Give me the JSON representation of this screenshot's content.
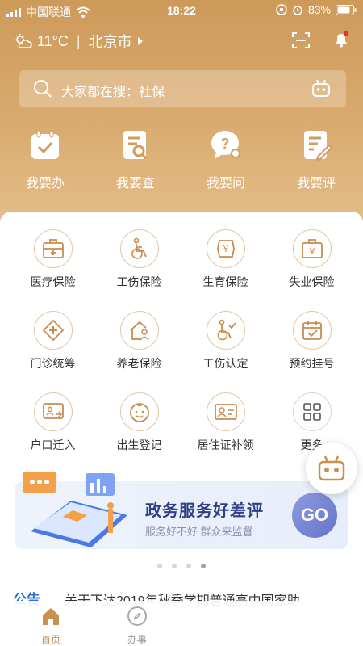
{
  "status": {
    "carrier": "中国联通",
    "time": "18:22",
    "battery": "83%"
  },
  "header": {
    "temperature": "11°C",
    "city": "北京市"
  },
  "search": {
    "placeholder": "大家都在搜：社保"
  },
  "quick_actions": [
    {
      "label": "我要办",
      "icon": "calendar-check-icon"
    },
    {
      "label": "我要查",
      "icon": "document-search-icon"
    },
    {
      "label": "我要问",
      "icon": "question-bubble-icon"
    },
    {
      "label": "我要评",
      "icon": "document-edit-icon"
    }
  ],
  "services": [
    {
      "label": "医疗保险",
      "icon": "medical-kit-icon"
    },
    {
      "label": "工伤保险",
      "icon": "wheelchair-icon"
    },
    {
      "label": "生育保险",
      "icon": "yen-shield-icon"
    },
    {
      "label": "失业保险",
      "icon": "yen-briefcase-icon"
    },
    {
      "label": "门诊统筹",
      "icon": "clinic-cross-icon"
    },
    {
      "label": "养老保险",
      "icon": "house-person-icon"
    },
    {
      "label": "工伤认定",
      "icon": "wheelchair-check-icon"
    },
    {
      "label": "预约挂号",
      "icon": "calendar-check-icon"
    },
    {
      "label": "户口迁入",
      "icon": "id-transfer-icon"
    },
    {
      "label": "出生登记",
      "icon": "baby-face-icon"
    },
    {
      "label": "居住证补领",
      "icon": "id-card-icon"
    },
    {
      "label": "更多",
      "icon": "grid-more-icon"
    }
  ],
  "banner": {
    "title": "政务服务好差评",
    "subtitle": "服务好不好  群众来监督",
    "button": "GO"
  },
  "notice": {
    "tag": "公告",
    "text": "关于下达2019年秋季学期普通高中国家助"
  },
  "tabs": [
    {
      "label": "首页",
      "active": true
    },
    {
      "label": "办事",
      "active": false
    }
  ],
  "colors": {
    "brand": "#cd9a5a",
    "accent_blue": "#2f3f86",
    "tab_active": "#c8914f"
  }
}
